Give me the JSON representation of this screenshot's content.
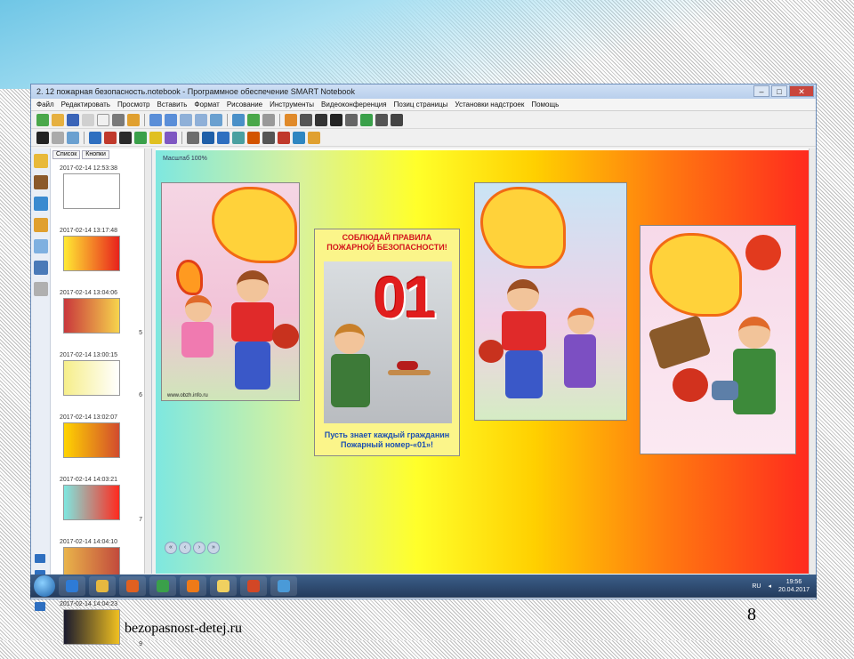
{
  "window": {
    "title": "2. 12 пожарная безопасность.notebook - Программное обеспечение SMART Notebook",
    "controls": {
      "minimize": "–",
      "maximize": "□",
      "close": "✕"
    }
  },
  "menu": [
    "Файл",
    "Редактировать",
    "Просмотр",
    "Вставить",
    "Формат",
    "Рисование",
    "Инструменты",
    "Видеоконференция",
    "Позиц страницы",
    "Установки надстроек",
    "Помощь"
  ],
  "sorter": {
    "tabs": [
      "Список",
      "Кнопки"
    ],
    "slides": [
      {
        "date": "2017-02-14 12:53:38",
        "num": "",
        "colors": [
          "#ffffff",
          "#ffffff"
        ]
      },
      {
        "date": "2017-02-14 13:17:48",
        "num": "",
        "colors": [
          "#ffea33",
          "#e8221c"
        ]
      },
      {
        "date": "2017-02-14 13:04:06",
        "num": "5",
        "colors": [
          "#c9373c",
          "#f6d44c"
        ]
      },
      {
        "date": "2017-02-14 13:00:15",
        "num": "6",
        "colors": [
          "#f6ee8a",
          "#ffffff"
        ]
      },
      {
        "date": "2017-02-14 13:02:07",
        "num": "",
        "colors": [
          "#ffd400",
          "#d24b2e"
        ]
      },
      {
        "date": "2017-02-14 14:03:21",
        "num": "7",
        "colors": [
          "#7ee7e0",
          "#ff2a1e"
        ]
      },
      {
        "date": "2017-02-14 14:04:10",
        "num": "8",
        "colors": [
          "#e9b44a",
          "#c24a3c"
        ]
      },
      {
        "date": "2017-02-14 14:04:23",
        "num": "9",
        "colors": [
          "#1a1a2e",
          "#f0c020"
        ]
      }
    ]
  },
  "canvas": {
    "zoom_label": "Масштаб 100%",
    "poster2": {
      "title_line1": "СОБЛЮДАЙ ПРАВИЛА",
      "title_line2": "ПОЖАРНОЙ БЕЗОПАСНОСТИ!",
      "number": "01",
      "caption_line1": "Пусть знает каждый гражданин",
      "caption_line2": "Пожарный номер-«01»!"
    },
    "poster1_credit": "www.obzh.info.ru"
  },
  "taskbar": {
    "lang": "RU",
    "time": "19:56",
    "date": "20.04.2017"
  },
  "footer": {
    "site": "bezopasnost-detej.ru",
    "page_number": "8"
  },
  "colors": {
    "gradient_start": "#7ee7e0",
    "gradient_mid": "#ffff2a",
    "gradient_end": "#ff2a1e",
    "poster2_title": "#d3151c",
    "poster2_caption": "#1d4fb0"
  }
}
